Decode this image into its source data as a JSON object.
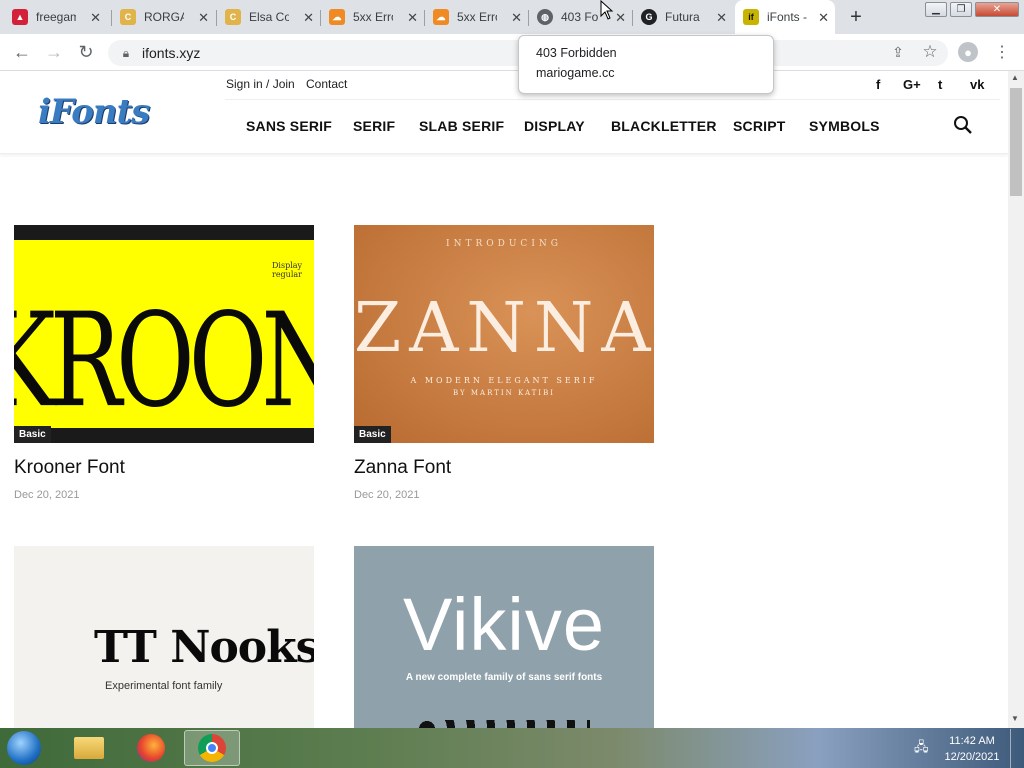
{
  "browser": {
    "tabs": [
      {
        "title": "freegam",
        "color": "#d3213a"
      },
      {
        "title": "RORGA",
        "color": "#e0b44b"
      },
      {
        "title": "Elsa Co",
        "color": "#e0b44b"
      },
      {
        "title": "5xx Erro",
        "color": "#f08a24"
      },
      {
        "title": "5xx Erro",
        "color": "#f08a24"
      },
      {
        "title": "403 Fo",
        "color": "#5f6368"
      },
      {
        "title": "Futura",
        "color": "#202124"
      },
      {
        "title": "iFonts -",
        "color": "#c8b400"
      }
    ],
    "url": "ifonts.xyz",
    "tooltip": {
      "title": "403 Forbidden",
      "host": "mariogame.cc"
    }
  },
  "site": {
    "logo": "iFonts",
    "top_links": {
      "signin": "Sign in / Join",
      "contact": "Contact"
    },
    "nav": [
      "SANS SERIF",
      "SERIF",
      "SLAB SERIF",
      "DISPLAY",
      "BLACKLETTER",
      "SCRIPT",
      "SYMBOLS"
    ],
    "social": [
      "f",
      "G+",
      "t",
      "vk"
    ]
  },
  "cards": [
    {
      "title": "Krooner Font",
      "date": "Dec 20, 2021",
      "badge": "Basic",
      "image_text": "KROONER",
      "image_sub": "Display regular",
      "bg": "#ffff00"
    },
    {
      "title": "Zanna Font",
      "date": "Dec 20, 2021",
      "badge": "Basic",
      "image_text": "ZANNA",
      "image_top": "INTRODUCING",
      "image_sub": "A MODERN ELEGANT SERIF",
      "image_by": "BY MARTIN KATIBI",
      "bg": "#c77a3e"
    },
    {
      "image_text": "TT Nooks",
      "image_sub": "Experimental font family",
      "bg": "#f4f2ee"
    },
    {
      "image_text": "Vikive",
      "image_sub": "A new complete family of sans serif fonts",
      "bg": "#8fa1ab"
    }
  ],
  "taskbar": {
    "time": "11:42 AM",
    "date": "12/20/2021"
  }
}
